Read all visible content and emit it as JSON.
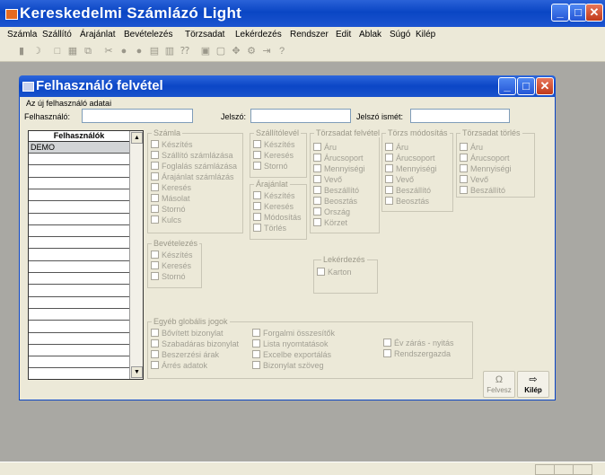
{
  "app": {
    "title": "Kereskedelmi Számlázó Light",
    "min_glyph": "_",
    "max_glyph": "□",
    "close_glyph": "✕"
  },
  "menu": [
    {
      "label": "Számla"
    },
    {
      "label": "Szállító"
    },
    {
      "label": "Árajánlat"
    },
    {
      "label": "Bevételezés"
    },
    {
      "label": "Törzsadat"
    },
    {
      "label": "Lekérdezés"
    },
    {
      "label": "Rendszer"
    },
    {
      "label": "Edit"
    },
    {
      "label": "Ablak"
    },
    {
      "label": "Súgó"
    },
    {
      "label": "Kilép"
    }
  ],
  "toolbar_icons": [
    {
      "name": "bars-chart-icon",
      "glyph": "▮"
    },
    {
      "name": "moon-icon",
      "glyph": "☽"
    },
    {
      "name": "new-page-icon",
      "glyph": "□"
    },
    {
      "name": "grid-icon",
      "glyph": "▦"
    },
    {
      "name": "copy-icon",
      "glyph": "⧉"
    },
    {
      "name": "cut-icon",
      "glyph": "✂"
    },
    {
      "name": "circle-icon",
      "glyph": "●"
    },
    {
      "name": "circle2-icon",
      "glyph": "●"
    },
    {
      "name": "chart-icon",
      "glyph": "▤"
    },
    {
      "name": "chart2-icon",
      "glyph": "▥"
    },
    {
      "name": "help-cursor-icon",
      "glyph": "⁇"
    },
    {
      "name": "window-icon",
      "glyph": "▣"
    },
    {
      "name": "window2-icon",
      "glyph": "▢"
    },
    {
      "name": "arrows-icon",
      "glyph": "✥"
    },
    {
      "name": "tools-icon",
      "glyph": "⚙"
    },
    {
      "name": "exit-icon",
      "glyph": "⇥"
    },
    {
      "name": "question-icon",
      "glyph": "?"
    }
  ],
  "dialog": {
    "title": "Felhasználó felvétel",
    "section_label": "Az új felhasználó adatai",
    "user_label": "Felhasználó:",
    "user_value": "",
    "password_label": "Jelszó:",
    "password_value": "",
    "password_repeat_label": "Jelszó ismét:",
    "password_repeat_value": "",
    "users_header": "Felhasználók",
    "users": [
      "DEMO"
    ],
    "scroll_up": "▲",
    "scroll_down": "▼",
    "save_label": "Felvesz",
    "save_icon": "Ω",
    "exit_label": "Kilép",
    "exit_icon": "⇨"
  },
  "groups": {
    "szamla": {
      "title": "Számla",
      "items": [
        "Készítés",
        "Szállító számlázása",
        "Foglalás számlázása",
        "Árajánlat számlázás",
        "Keresés",
        "Másolat",
        "Stornó",
        "Kulcs"
      ]
    },
    "szallitolevel": {
      "title": "Szállítólevél",
      "items": [
        "Készítés",
        "Keresés",
        "Stornó"
      ]
    },
    "torzsadat_felvetel": {
      "title": "Törzsadat felvétel",
      "items": [
        "Áru",
        "Árucsoport",
        "Mennyiségi",
        "Vevő",
        "Beszállító",
        "Beosztás",
        "Ország",
        "Körzet"
      ]
    },
    "torzs_modositas": {
      "title": "Törzs módosítás",
      "items": [
        "Áru",
        "Árucsoport",
        "Mennyiségi",
        "Vevő",
        "Beszállító",
        "Beosztás"
      ]
    },
    "torzsadat_torles": {
      "title": "Törzsadat törlés",
      "items": [
        "Áru",
        "Árucsoport",
        "Mennyiségi",
        "Vevő",
        "Beszállító"
      ]
    },
    "arajanlat": {
      "title": "Árajánlat",
      "items": [
        "Készítés",
        "Keresés",
        "Módosítás",
        "Törlés"
      ]
    },
    "bevetelezes": {
      "title": "Bevételezés",
      "items": [
        "Készítés",
        "Keresés",
        "Stornó"
      ]
    },
    "lekerdezes": {
      "title": "Lekérdezés",
      "items": [
        "Karton"
      ]
    },
    "egyeb": {
      "title": "Egyéb globális jogok",
      "col1": [
        "Bővített bizonylat",
        "Szabadáras bizonylat",
        "Beszerzési árak",
        "Árrés adatok"
      ],
      "col2": [
        "Forgalmi összesítők",
        "Lista nyomtatások",
        "Excelbe exportálás",
        "Bizonylat szöveg"
      ],
      "col3": [
        "Év zárás - nyitás",
        "Rendszergazda"
      ]
    }
  }
}
